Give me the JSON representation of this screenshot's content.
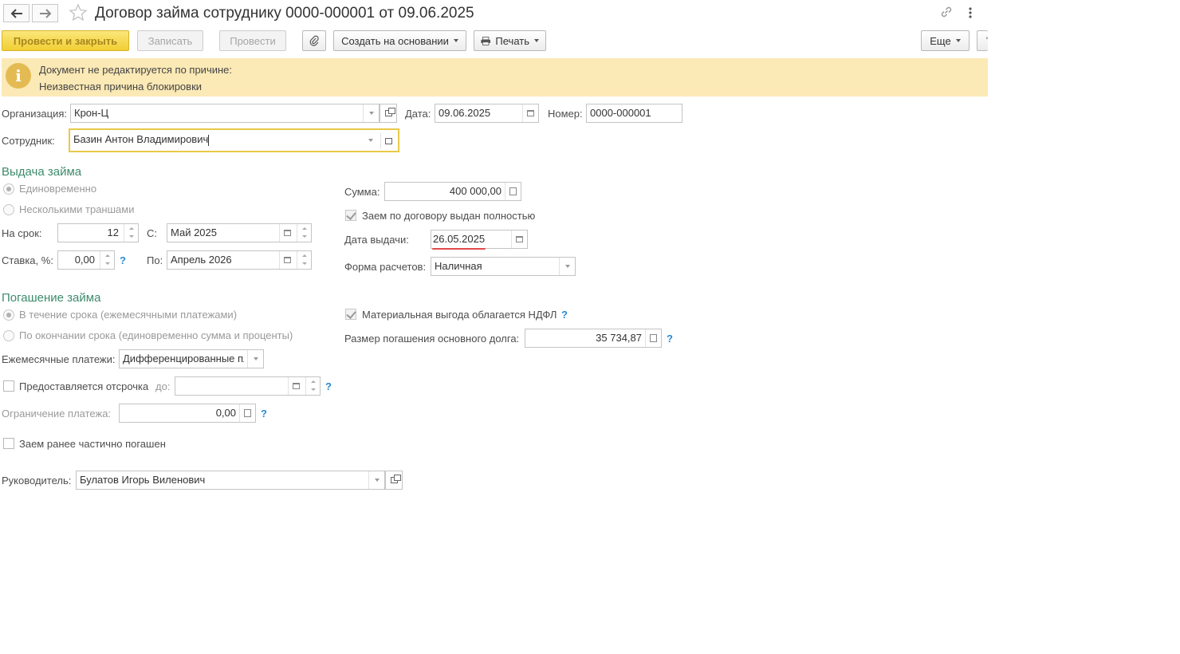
{
  "title": "Договор займа сотруднику 0000-000001 от 09.06.2025",
  "toolbar": {
    "post_close": "Провести и закрыть",
    "save": "Записать",
    "post": "Провести",
    "create_based_on": "Создать на основании",
    "print": "Печать",
    "more": "Еще"
  },
  "info": {
    "line1": "Документ не редактируется по причине:",
    "line2": "Неизвестная причина блокировки"
  },
  "header": {
    "org_label": "Организация:",
    "org_value": "Крон-Ц",
    "date_label": "Дата:",
    "date_value": "09.06.2025",
    "number_label": "Номер:",
    "number_value": "0000-000001",
    "employee_label": "Сотрудник:",
    "employee_value": "Базин Антон Владимирович"
  },
  "issue": {
    "title": "Выдача займа",
    "option_once": "Единовременно",
    "option_tranches": "Несколькими траншами",
    "term_label": "На срок:",
    "term_value": "12",
    "from_label": "С:",
    "from_value": "Май 2025",
    "rate_label": "Ставка, %:",
    "rate_value": "0,00",
    "to_label": "По:",
    "to_value": "Апрель 2026",
    "sum_label": "Сумма:",
    "sum_value": "400 000,00",
    "issued_fully_label": "Заем по договору выдан полностью",
    "issue_date_label": "Дата выдачи:",
    "issue_date_value": "26.05.2025",
    "payment_form_label": "Форма расчетов:",
    "payment_form_value": "Наличная"
  },
  "repayment": {
    "title": "Погашение займа",
    "option_monthly": "В течение срока (ежемесячными платежами)",
    "option_end": "По окончании срока (единовременно сумма и проценты)",
    "monthly_label": "Ежемесячные платежи:",
    "monthly_value": "Дифференцированные пл",
    "deferral_label": "Предоставляется отсрочка",
    "deferral_until_label": "до:",
    "deferral_until_value": "",
    "limit_label": "Ограничение платежа:",
    "limit_value": "0,00",
    "partially_repaid_label": "Заем ранее частично погашен",
    "ndfl_label": "Материальная выгода облагается НДФЛ",
    "principal_label": "Размер погашения основного долга:",
    "principal_value": "35 734,87"
  },
  "footer": {
    "manager_label": "Руководитель:",
    "manager_value": "Булатов Игорь Виленович"
  },
  "help_mark": "?",
  "info_icon_glyph": "i",
  "colors": {
    "accent_green": "#3d8a6c",
    "primary_button": "#f1cf34",
    "info_bar": "#fbe9b6",
    "help": "#2a8ad4",
    "underline": "#e24a4a"
  }
}
